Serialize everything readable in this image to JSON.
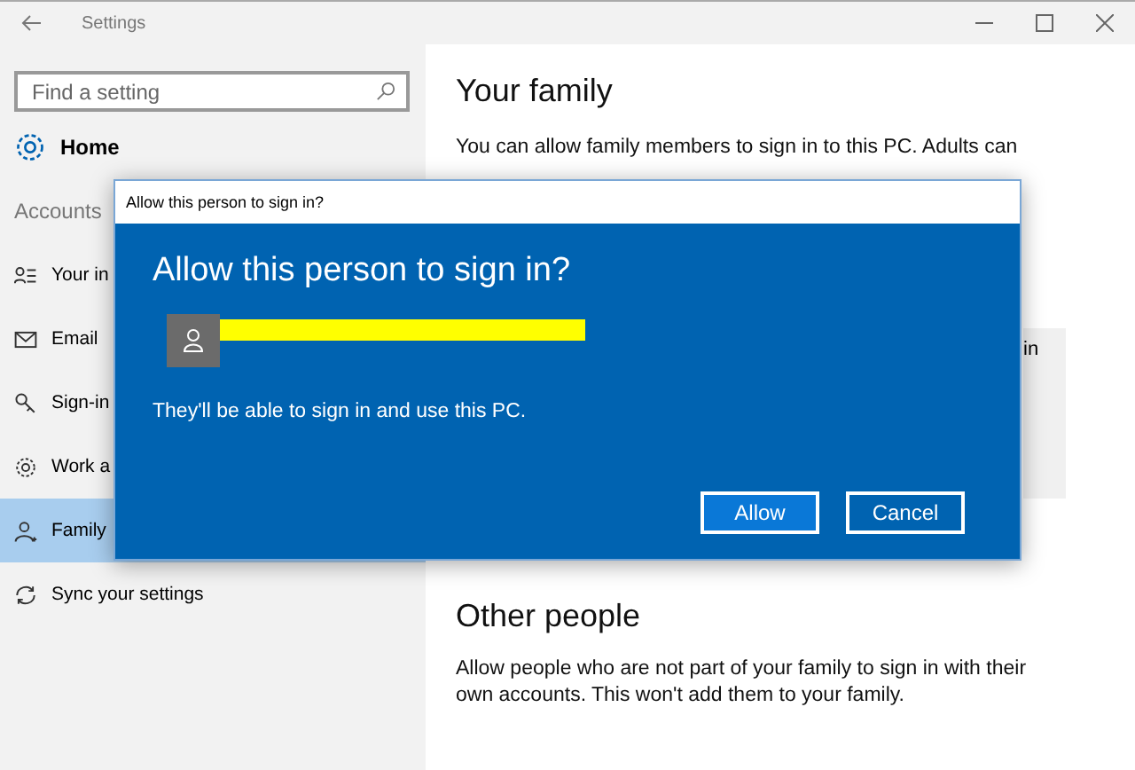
{
  "window": {
    "title": "Settings"
  },
  "sidebar": {
    "search": {
      "placeholder": "Find a setting"
    },
    "home": "Home",
    "section": "Accounts",
    "items": [
      {
        "label": "Your in",
        "selected": false
      },
      {
        "label": "Email",
        "selected": false
      },
      {
        "label": "Sign-in",
        "selected": false
      },
      {
        "label": "Work a",
        "selected": false
      },
      {
        "label": "Family",
        "selected": true
      },
      {
        "label": "Sync your settings",
        "selected": false
      }
    ]
  },
  "content": {
    "family_heading": "Your family",
    "family_text": "You can allow family members to sign in to this PC. Adults can",
    "card_text": "in",
    "other_heading": "Other people",
    "other_text": "Allow people who are not part of your family to sign in with their own accounts. This won't add them to your family."
  },
  "dialog": {
    "title": "Allow this person to sign in?",
    "heading": "Allow this person to sign in?",
    "message": "They'll be able to sign in and use this PC.",
    "buttons": [
      {
        "label": "Allow",
        "selected": true
      },
      {
        "label": "Cancel",
        "selected": false
      }
    ]
  }
}
